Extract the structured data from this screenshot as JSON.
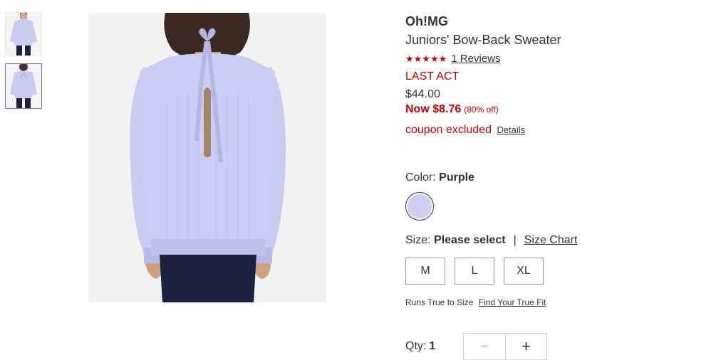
{
  "product": {
    "brand": "Oh!MG",
    "name": "Juniors' Bow-Back Sweater",
    "stars": "★★★★★",
    "reviews": "1 Reviews",
    "event": "LAST ACT",
    "original_price": "$44.00",
    "now_price": "Now $8.76",
    "discount": "(80% off)",
    "coupon": "coupon excluded",
    "details_link": "Details"
  },
  "color": {
    "label": "Color:",
    "selected": "Purple",
    "swatch_color": "#cfd0f2"
  },
  "size": {
    "label": "Size:",
    "selected": "Please select",
    "separator": "|",
    "chart_link": "Size Chart",
    "options": [
      "M",
      "L",
      "XL"
    ],
    "fit_text": "Runs True to Size",
    "fit_link": "Find Your True Fit"
  },
  "quantity": {
    "label": "Qty:",
    "value": "1",
    "minus": "−",
    "plus": "+"
  },
  "theme": {
    "accent_red": "#cc0000",
    "sweater": "#c9cbf0",
    "selected_thumb_border": "#8a6bc4"
  }
}
